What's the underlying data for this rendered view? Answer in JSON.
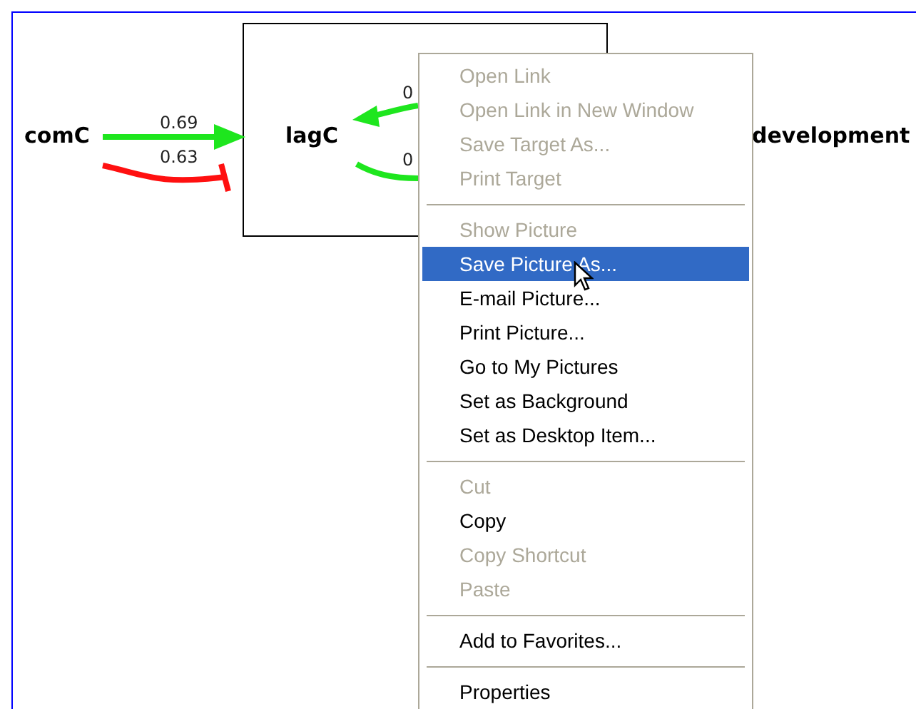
{
  "diagram": {
    "nodes": [
      {
        "label": "comC"
      },
      {
        "label": "lagC"
      },
      {
        "label": "development"
      }
    ],
    "edges": [
      {
        "label": "0.69",
        "kind": "activation"
      },
      {
        "label": "0.63",
        "kind": "inhibition"
      },
      {
        "label": "0",
        "kind": "activation"
      },
      {
        "label": "0",
        "kind": "activation"
      }
    ]
  },
  "context_menu": {
    "items": [
      {
        "kind": "item",
        "label": "Open Link",
        "disabled": true,
        "selected": false
      },
      {
        "kind": "item",
        "label": "Open Link in New Window",
        "disabled": true,
        "selected": false
      },
      {
        "kind": "item",
        "label": "Save Target As...",
        "disabled": true,
        "selected": false
      },
      {
        "kind": "item",
        "label": "Print Target",
        "disabled": true,
        "selected": false
      },
      {
        "kind": "separator"
      },
      {
        "kind": "item",
        "label": "Show Picture",
        "disabled": true,
        "selected": false
      },
      {
        "kind": "item",
        "label": "Save Picture As...",
        "disabled": false,
        "selected": true
      },
      {
        "kind": "item",
        "label": "E-mail Picture...",
        "disabled": false,
        "selected": false
      },
      {
        "kind": "item",
        "label": "Print Picture...",
        "disabled": false,
        "selected": false
      },
      {
        "kind": "item",
        "label": "Go to My Pictures",
        "disabled": false,
        "selected": false
      },
      {
        "kind": "item",
        "label": "Set as Background",
        "disabled": false,
        "selected": false
      },
      {
        "kind": "item",
        "label": "Set as Desktop Item...",
        "disabled": false,
        "selected": false
      },
      {
        "kind": "separator"
      },
      {
        "kind": "item",
        "label": "Cut",
        "disabled": true,
        "selected": false
      },
      {
        "kind": "item",
        "label": "Copy",
        "disabled": false,
        "selected": false
      },
      {
        "kind": "item",
        "label": "Copy Shortcut",
        "disabled": true,
        "selected": false
      },
      {
        "kind": "item",
        "label": "Paste",
        "disabled": true,
        "selected": false
      },
      {
        "kind": "separator"
      },
      {
        "kind": "item",
        "label": "Add to Favorites...",
        "disabled": false,
        "selected": false
      },
      {
        "kind": "separator"
      },
      {
        "kind": "item",
        "label": "Properties",
        "disabled": false,
        "selected": false
      }
    ]
  }
}
